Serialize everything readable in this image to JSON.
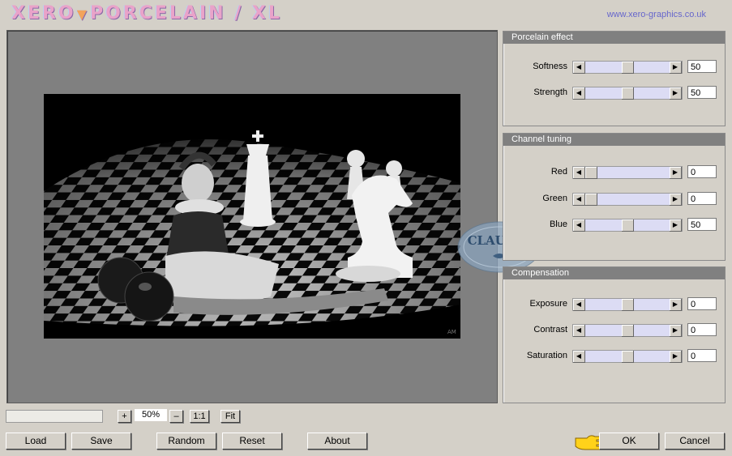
{
  "title": {
    "logo_left": "XERO",
    "logo_right": "PORCELAIN / XL",
    "url": "www.xero-graphics.co.uk"
  },
  "panels": {
    "porcelain": {
      "header": "Porcelain effect",
      "rows": [
        {
          "label": "Softness",
          "value": "50",
          "level": 0.5
        },
        {
          "label": "Strength",
          "value": "50",
          "level": 0.5
        }
      ]
    },
    "channel": {
      "header": "Channel tuning",
      "rows": [
        {
          "label": "Red",
          "value": "0",
          "level": 0.0
        },
        {
          "label": "Green",
          "value": "0",
          "level": 0.0
        },
        {
          "label": "Blue",
          "value": "50",
          "level": 0.5
        }
      ]
    },
    "compensation": {
      "header": "Compensation",
      "rows": [
        {
          "label": "Exposure",
          "value": "0",
          "level": 0.5
        },
        {
          "label": "Contrast",
          "value": "0",
          "level": 0.5
        },
        {
          "label": "Saturation",
          "value": "0",
          "level": 0.5
        }
      ]
    }
  },
  "zoom": {
    "plus": "+",
    "value": "50%",
    "minus": "–",
    "one_to_one": "1:1",
    "fit": "Fit"
  },
  "buttons": {
    "load": "Load",
    "save": "Save",
    "random": "Random",
    "reset": "Reset",
    "about": "About",
    "ok": "OK",
    "cancel": "Cancel"
  },
  "watermark": {
    "text": "CLAUDIA"
  },
  "colors": {
    "slider_track": "#dcdcf4",
    "panel_header": "#808080",
    "preview_bg": "#808080"
  },
  "icons": {
    "pointer": "pointing-hand-icon",
    "left": "arrow-left-icon",
    "right": "arrow-right-icon"
  }
}
